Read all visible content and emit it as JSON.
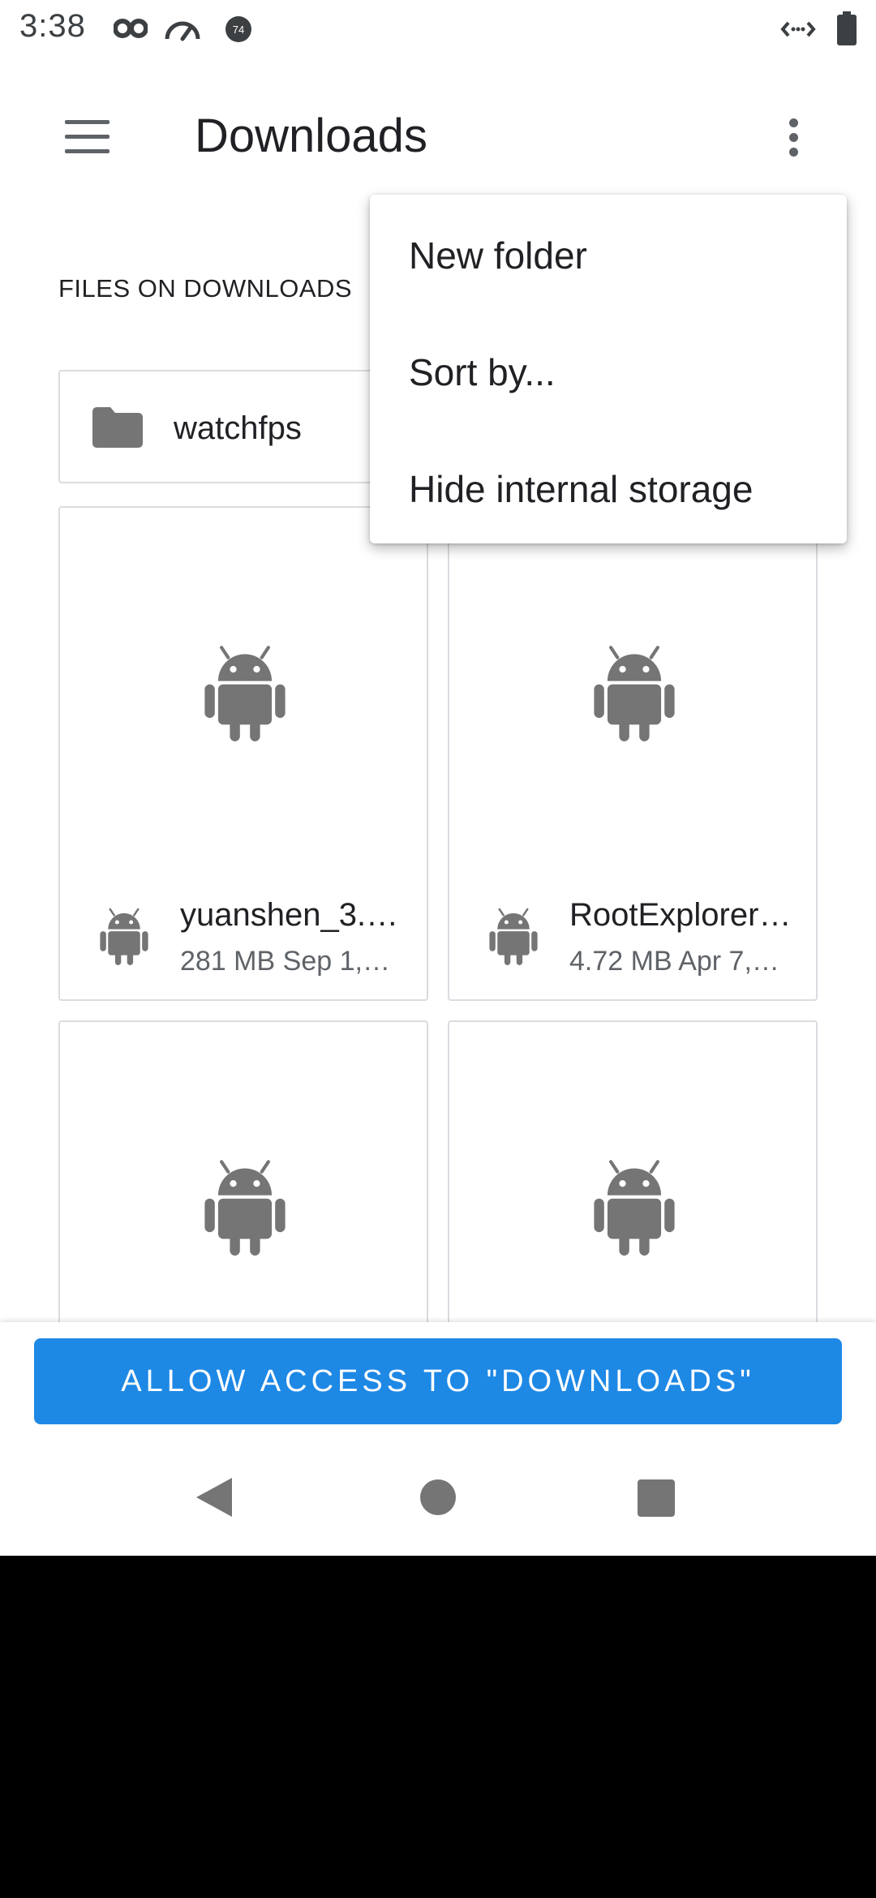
{
  "status_bar": {
    "time": "3:38",
    "left_icons": [
      "incognito-icon",
      "speedometer-icon",
      "notification-badge-icon"
    ],
    "badge_text": "74",
    "right_icons": [
      "data-transfer-icon",
      "battery-icon"
    ]
  },
  "app_bar": {
    "title": "Downloads",
    "menu_icon": "hamburger-menu-icon",
    "overflow_icon": "more-vert-icon"
  },
  "section_label": "FILES ON DOWNLOADS",
  "folders": [
    {
      "name": "watchfps",
      "icon": "folder-icon"
    }
  ],
  "files": [
    {
      "name": "yuanshen_3.…",
      "size": "281 MB",
      "date": "Sep 1,…",
      "icon": "android-icon"
    },
    {
      "name": "RootExplorer…",
      "size": "4.72 MB",
      "date": "Apr 7,…",
      "icon": "android-icon"
    },
    {
      "name": "",
      "size": "",
      "date": "",
      "icon": "android-icon"
    },
    {
      "name": "",
      "size": "",
      "date": "",
      "icon": "android-icon"
    }
  ],
  "overflow_menu": {
    "items": [
      "New folder",
      "Sort by...",
      "Hide internal storage"
    ]
  },
  "allow_button": {
    "label": "ALLOW ACCESS TO \"DOWNLOADS\""
  },
  "colors": {
    "accent": "#1e88e5",
    "icon_gray": "#757575",
    "card_border": "#dadce0",
    "text_primary": "#202124",
    "text_secondary": "#5f6368"
  },
  "nav_bar": {
    "buttons": [
      "back-icon",
      "home-icon",
      "recents-icon"
    ]
  }
}
